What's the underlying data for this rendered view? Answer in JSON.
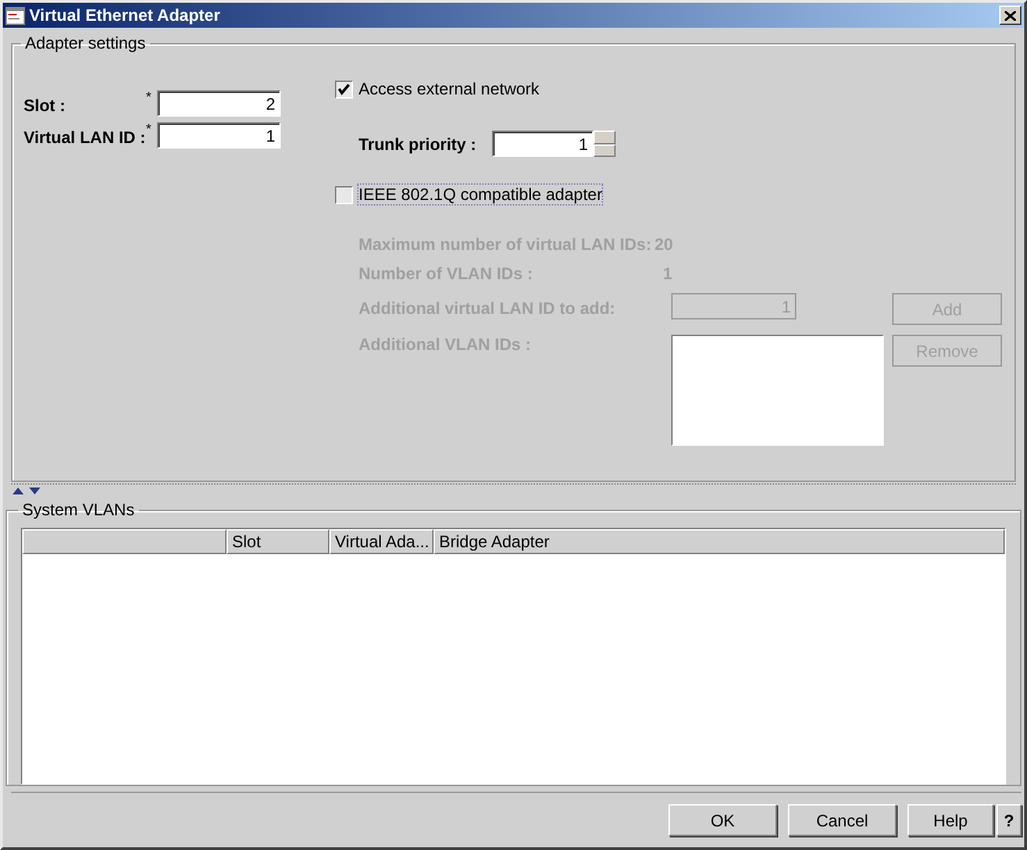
{
  "window": {
    "title": "Virtual Ethernet Adapter"
  },
  "adapter_settings": {
    "title": "Adapter settings",
    "fields": [
      {
        "label": "Slot :",
        "required_mark": "*",
        "value": "2"
      },
      {
        "label": "Virtual LAN ID :",
        "required_mark": "*",
        "value": "1"
      }
    ],
    "access_external": {
      "label": "Access external network",
      "checked": true
    },
    "trunk_priority": {
      "label": "Trunk priority :",
      "value": "1"
    },
    "ieee": {
      "label": "IEEE 802.1Q compatible adapter",
      "checked": false
    },
    "vlan_info": {
      "disabled": true,
      "max_label": "Maximum number of virtual LAN IDs:",
      "max_value": "20",
      "count_label": "Number of VLAN IDs :",
      "count_value": "1",
      "add_label": "Additional virtual LAN ID to add:",
      "add_value": "1",
      "list_label": "Additional VLAN IDs :",
      "add_button": "Add",
      "remove_button": "Remove"
    }
  },
  "system_vlans": {
    "title": "System VLANs",
    "columns": [
      "Slot",
      "Virtual Ada...",
      "Bridge Adapter"
    ]
  },
  "buttons": [
    "OK",
    "Cancel",
    "Help",
    "?"
  ]
}
